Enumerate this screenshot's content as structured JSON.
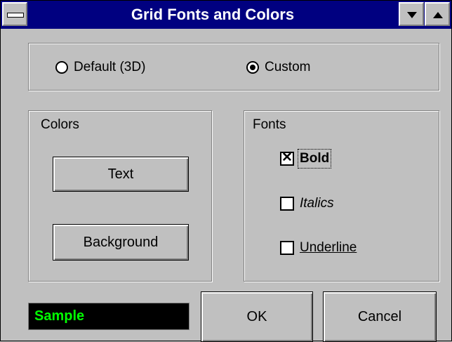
{
  "window": {
    "title": "Grid Fonts and Colors"
  },
  "style_mode": {
    "options": [
      {
        "label": "Default (3D)",
        "selected": false
      },
      {
        "label": "Custom",
        "selected": true
      }
    ]
  },
  "colors_group": {
    "label": "Colors",
    "text_button": "Text",
    "background_button": "Background"
  },
  "fonts_group": {
    "label": "Fonts",
    "bold": {
      "label": "Bold",
      "checked": true
    },
    "italics": {
      "label": "Italics",
      "checked": false
    },
    "underline": {
      "label": "Underline",
      "checked": false
    }
  },
  "sample": {
    "text": "Sample",
    "text_color": "#00ff00",
    "background_color": "#000000"
  },
  "actions": {
    "ok": "OK",
    "cancel": "Cancel"
  }
}
